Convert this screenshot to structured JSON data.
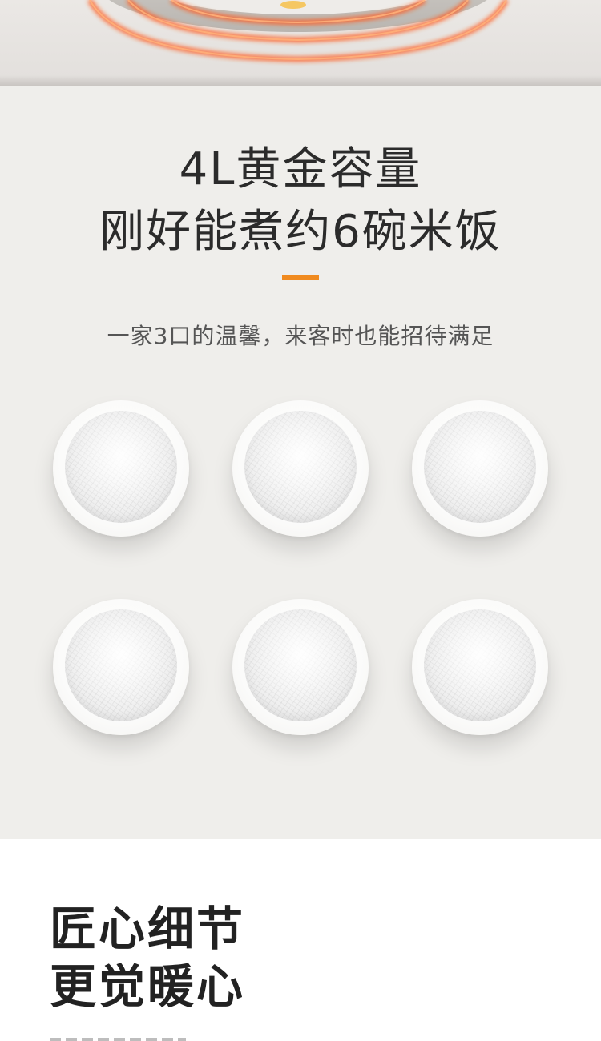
{
  "hero": {
    "glow_color": "#f26a2a",
    "rim_color": "#c8c5c1"
  },
  "capacity": {
    "headline_line1": "4L黄金容量",
    "headline_line2": "刚好能煮约6碗米饭",
    "accent_color": "#f08a1f",
    "subline": "一家3口的温馨，来客时也能招待满足",
    "bowl_count": 6
  },
  "details": {
    "title_line1": "匠心细节",
    "title_line2": "更觉暖心"
  }
}
